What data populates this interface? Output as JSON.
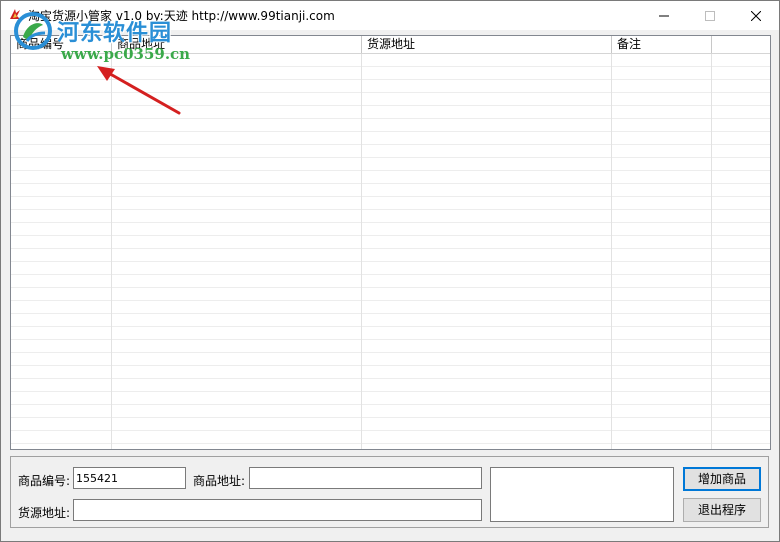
{
  "window": {
    "title": "淘宝货源小管家 v1.0   by:天迹 http://www.99tianji.com"
  },
  "watermark": {
    "brand": "河东软件园",
    "url": "www.pc0359.cn"
  },
  "table": {
    "columns": [
      "商品编号",
      "商品地址",
      "货源地址",
      "备注"
    ],
    "rows": []
  },
  "form": {
    "product_id_label": "商品编号:",
    "product_id_value": "155421",
    "product_url_label": "商品地址:",
    "product_url_value": "",
    "source_url_label": "货源地址:",
    "source_url_value": "",
    "notes_value": ""
  },
  "buttons": {
    "add": "增加商品",
    "exit": "退出程序"
  },
  "colors": {
    "arrow": "#d42020",
    "watermark_blue": "#2a8fd6",
    "watermark_green": "#3aa94a"
  }
}
